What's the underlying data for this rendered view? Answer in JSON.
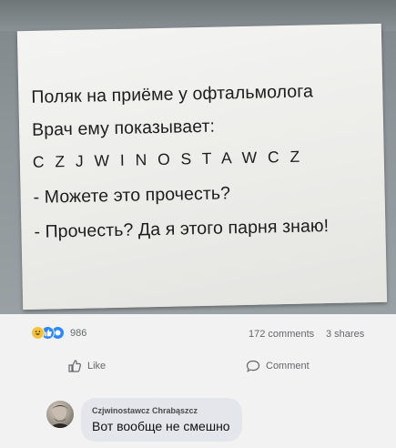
{
  "post": {
    "image": {
      "lines": [
        "Поляк на приёме у офтальмолога",
        "Врач ему показывает:",
        "C Z J W I N O S T A W C Z",
        "- Можете это прочесть?",
        "- Прочесть? Да я этого парня знаю!"
      ]
    },
    "stats": {
      "reactions": [
        "haha-icon",
        "like-icon",
        "love-icon"
      ],
      "reaction_count": "986",
      "comments": "172 comments",
      "shares": "3 shares"
    },
    "actions": {
      "like_label": "Like",
      "comment_label": "Comment"
    }
  },
  "comment": {
    "author": "Czjwinostawcz Chrabąszcz",
    "text": "Вот вообще не смешно"
  },
  "colors": {
    "background": "#f2f2f2",
    "bubble": "#e4e6eb",
    "like_blue": "#2d88ff",
    "haha_yellow": "#f5c33b",
    "muted_text": "#65676b"
  }
}
